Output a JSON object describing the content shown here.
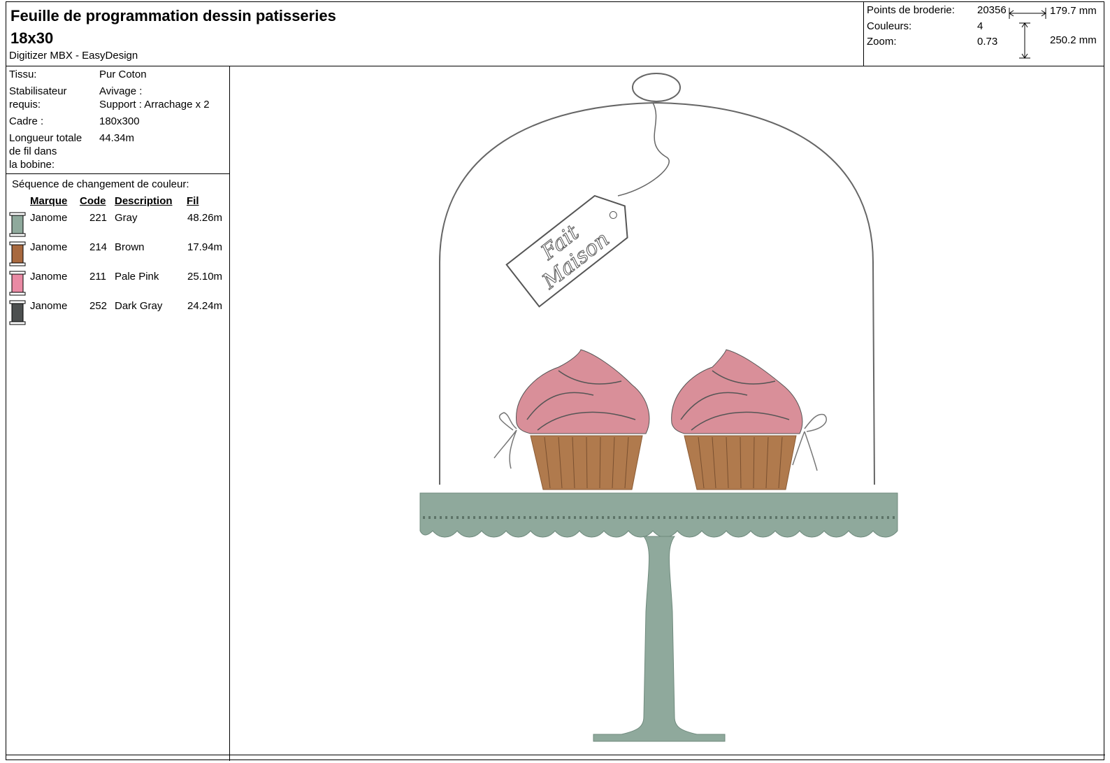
{
  "header": {
    "title": "Feuille de programmation dessin patisseries 18x30",
    "subtitle": "Digitizer MBX - EasyDesign"
  },
  "stats": {
    "points_label": "Points de broderie:",
    "points_value": "20356",
    "colors_label": "Couleurs:",
    "colors_value": "4",
    "zoom_label": "Zoom:",
    "zoom_value": "0.73",
    "width": "179.7 mm",
    "height": "250.2 mm"
  },
  "props": {
    "tissu_label": "Tissu:",
    "tissu_value": "Pur Coton",
    "stab_label_1": "Stabilisateur",
    "stab_label_2": "requis:",
    "stab_value_1": "Avivage :",
    "stab_value_2": "Support : Arrachage x 2",
    "cadre_label": "Cadre :",
    "cadre_value": "180x300",
    "longueur_label_1": "Longueur totale",
    "longueur_label_2": "de fil dans",
    "longueur_label_3": "la bobine:",
    "longueur_value": "44.34m"
  },
  "sequence": {
    "title": "Séquence de changement de couleur:",
    "columns": [
      "Marque",
      "Code",
      "Description",
      "Fil"
    ],
    "rows": [
      {
        "brand": "Janome",
        "code": "221",
        "desc": "Gray",
        "fil": "48.26m",
        "color": "#8fa99c"
      },
      {
        "brand": "Janome",
        "code": "214",
        "desc": "Brown",
        "fil": "17.94m",
        "color": "#a8693f"
      },
      {
        "brand": "Janome",
        "code": "211",
        "desc": "Pale Pink",
        "fil": "25.10m",
        "color": "#e98aa4"
      },
      {
        "brand": "Janome",
        "code": "252",
        "desc": "Dark Gray",
        "fil": "24.24m",
        "color": "#4d5050"
      }
    ]
  },
  "design": {
    "tag_line_1": "Fait",
    "tag_line_2": "Maison",
    "colors": {
      "stand": "#8fa99c",
      "frosting": "#d98f99",
      "cup": "#b07a4d",
      "outline": "#555555"
    }
  }
}
